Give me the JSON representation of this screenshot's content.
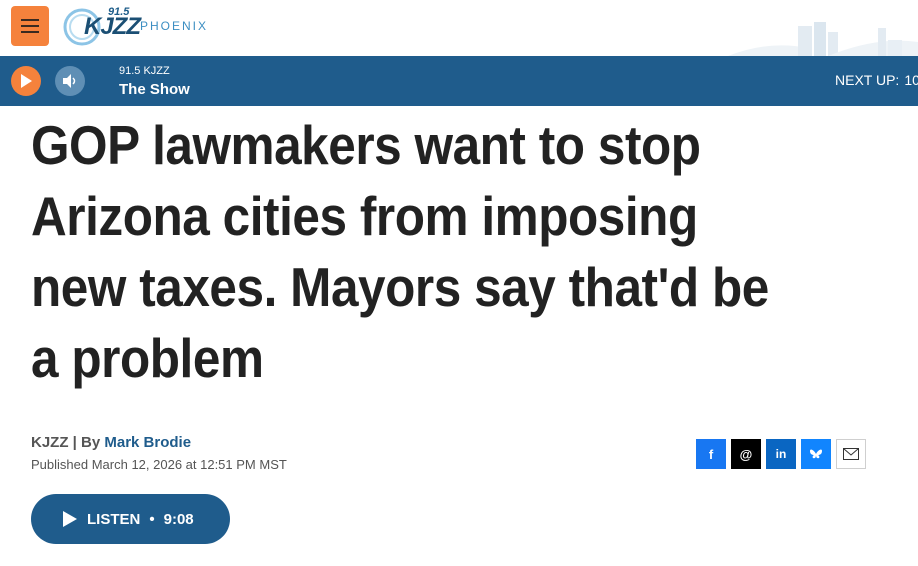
{
  "header": {
    "menu_icon": "hamburger-menu-icon",
    "logo": {
      "frequency": "91.5",
      "name": "KJZZ",
      "city": "PHOENIX"
    }
  },
  "player": {
    "station": "91.5 KJZZ",
    "show": "The Show",
    "next_up_label": "NEXT UP:",
    "next_up_value": "10",
    "play_icon": "play-icon",
    "volume_icon": "volume-icon",
    "colors": {
      "bar": "#1f5c8c",
      "play": "#f5823c"
    }
  },
  "article": {
    "headline": "GOP lawmakers want to stop Arizona cities from imposing new taxes. Mayors say that'd be a problem",
    "source": "KJZZ",
    "by_separator": " | By ",
    "author": "Mark Brodie",
    "published": "Published March 12, 2026 at 12:51 PM MST"
  },
  "share": [
    {
      "name": "facebook",
      "icon": "facebook-icon",
      "glyph": "f"
    },
    {
      "name": "threads",
      "icon": "threads-icon",
      "glyph": "@"
    },
    {
      "name": "linkedin",
      "icon": "linkedin-icon",
      "glyph": "in"
    },
    {
      "name": "bluesky",
      "icon": "bluesky-icon",
      "glyph": ""
    },
    {
      "name": "email",
      "icon": "email-icon",
      "glyph": ""
    }
  ],
  "listen": {
    "label": "LISTEN",
    "separator": "•",
    "duration": "9:08"
  }
}
